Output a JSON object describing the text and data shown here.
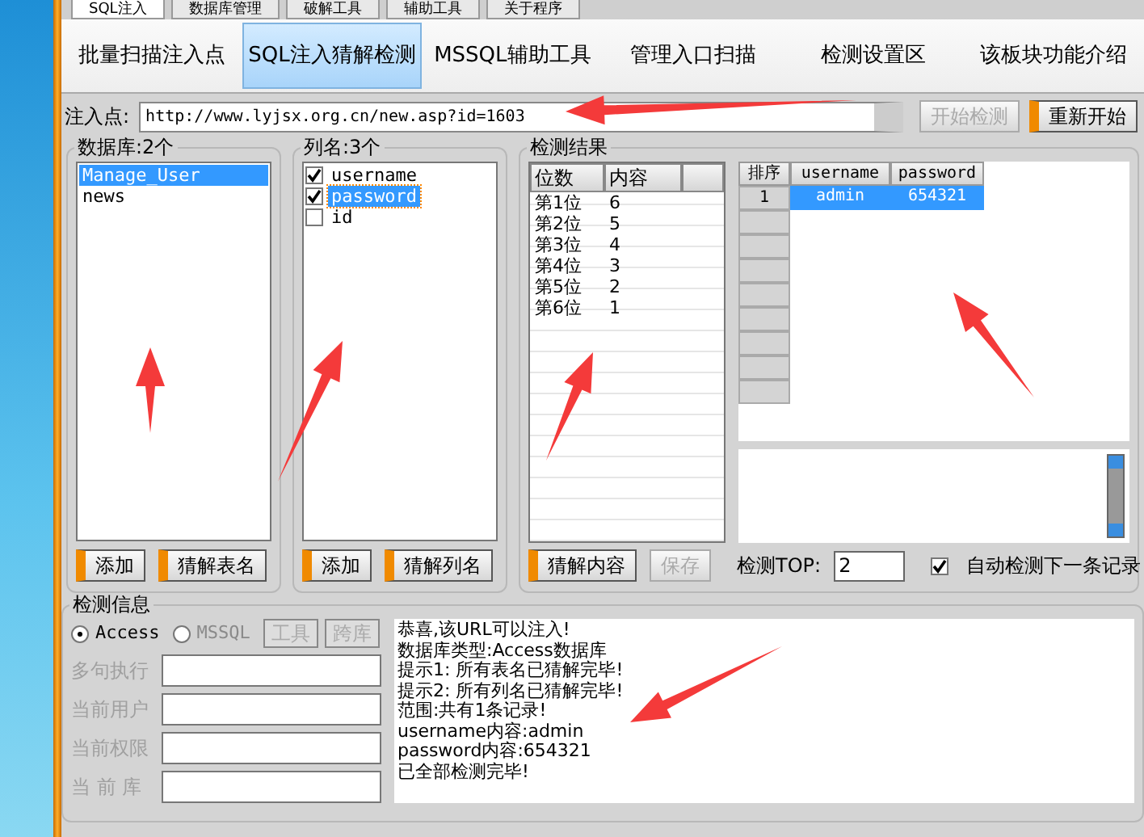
{
  "app_tabs": [
    {
      "label": "SQL注入",
      "selected": true
    },
    {
      "label": "数据库管理",
      "selected": false
    },
    {
      "label": "破解工具",
      "selected": false
    },
    {
      "label": "辅助工具",
      "selected": false
    },
    {
      "label": "关于程序",
      "selected": false
    }
  ],
  "sub_tabs": [
    {
      "label": "批量扫描注入点",
      "selected": false
    },
    {
      "label": "SQL注入猜解检测",
      "selected": true
    },
    {
      "label": "MSSQL辅助工具",
      "selected": false
    },
    {
      "label": "管理入口扫描",
      "selected": false
    },
    {
      "label": "检测设置区",
      "selected": false
    },
    {
      "label": "该板块功能介绍",
      "selected": false
    }
  ],
  "injection": {
    "label": "注入点:",
    "value": "http://www.lyjsx.org.cn/new.asp?id=1603",
    "buttons": [
      {
        "label": "开始检测",
        "disabled": true
      },
      {
        "label": "重新开始",
        "disabled": false
      }
    ]
  },
  "tables_panel": {
    "title": "数据库:2个",
    "items": [
      {
        "label": "Manage_User",
        "selected": true
      },
      {
        "label": "news",
        "selected": false
      }
    ],
    "buttons": [
      "添加",
      "猜解表名"
    ]
  },
  "columns_panel": {
    "title": "列名:3个",
    "items": [
      {
        "label": "username",
        "checked": true,
        "selected": false
      },
      {
        "label": "password",
        "checked": true,
        "selected": true
      },
      {
        "label": "id",
        "checked": false,
        "selected": false
      }
    ],
    "buttons": [
      "添加",
      "猜解列名"
    ]
  },
  "results": {
    "title": "检测结果",
    "digits_table": {
      "columns": [
        "位数",
        "内容"
      ],
      "rows": [
        [
          "第1位",
          "6"
        ],
        [
          "第2位",
          "5"
        ],
        [
          "第3位",
          "4"
        ],
        [
          "第4位",
          "3"
        ],
        [
          "第5位",
          "2"
        ],
        [
          "第6位",
          "1"
        ]
      ]
    },
    "data_grid": {
      "columns": [
        "排序",
        "username",
        "password"
      ],
      "rows": [
        {
          "cells": [
            "1",
            "admin",
            "654321"
          ],
          "selected": true
        }
      ]
    },
    "buttons": [
      {
        "label": "猜解内容",
        "disabled": false
      },
      {
        "label": "保存",
        "disabled": true
      }
    ],
    "top_label": "检测TOP:",
    "top_value": "2",
    "auto_next": {
      "label": "自动检测下一条记录",
      "checked": true
    }
  },
  "info": {
    "title": "检测信息",
    "db_types": [
      {
        "label": "Access",
        "selected": true,
        "disabled": false
      },
      {
        "label": "MSSQL",
        "selected": false,
        "disabled": true
      }
    ],
    "buttons": [
      {
        "label": "工具",
        "disabled": true
      },
      {
        "label": "跨库",
        "disabled": true
      }
    ],
    "fields": [
      {
        "label": "多句执行",
        "disabled": true
      },
      {
        "label": "当前用户",
        "disabled": true
      },
      {
        "label": "当前权限",
        "disabled": true
      },
      {
        "label": "当 前 库",
        "disabled": true
      }
    ],
    "log": [
      "恭喜,该URL可以注入!",
      "数据库类型:Access数据库",
      "提示1: 所有表名已猜解完毕!",
      "提示2: 所有列名已猜解完毕!",
      "范围:共有1条记录!",
      "username内容:admin",
      "password内容:654321",
      "已全部检测完毕!"
    ]
  }
}
